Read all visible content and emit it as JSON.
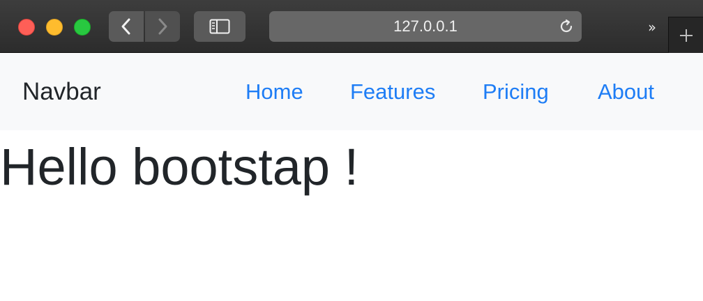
{
  "browser": {
    "address": "127.0.0.1",
    "icons": {
      "back": "chevron-left-icon",
      "forward": "chevron-right-icon",
      "sidebar": "sidebar-icon",
      "reload": "reload-icon",
      "overflow": "double-chevron-right-icon",
      "new_tab": "plus-icon"
    },
    "overflow_glyph": "››"
  },
  "navbar": {
    "brand": "Navbar",
    "links": [
      {
        "label": "Home"
      },
      {
        "label": "Features"
      },
      {
        "label": "Pricing"
      },
      {
        "label": "About"
      }
    ],
    "link_color": "#1e7df5",
    "background": "#f8f9fa"
  },
  "main": {
    "heading": "Hello bootstap !"
  }
}
